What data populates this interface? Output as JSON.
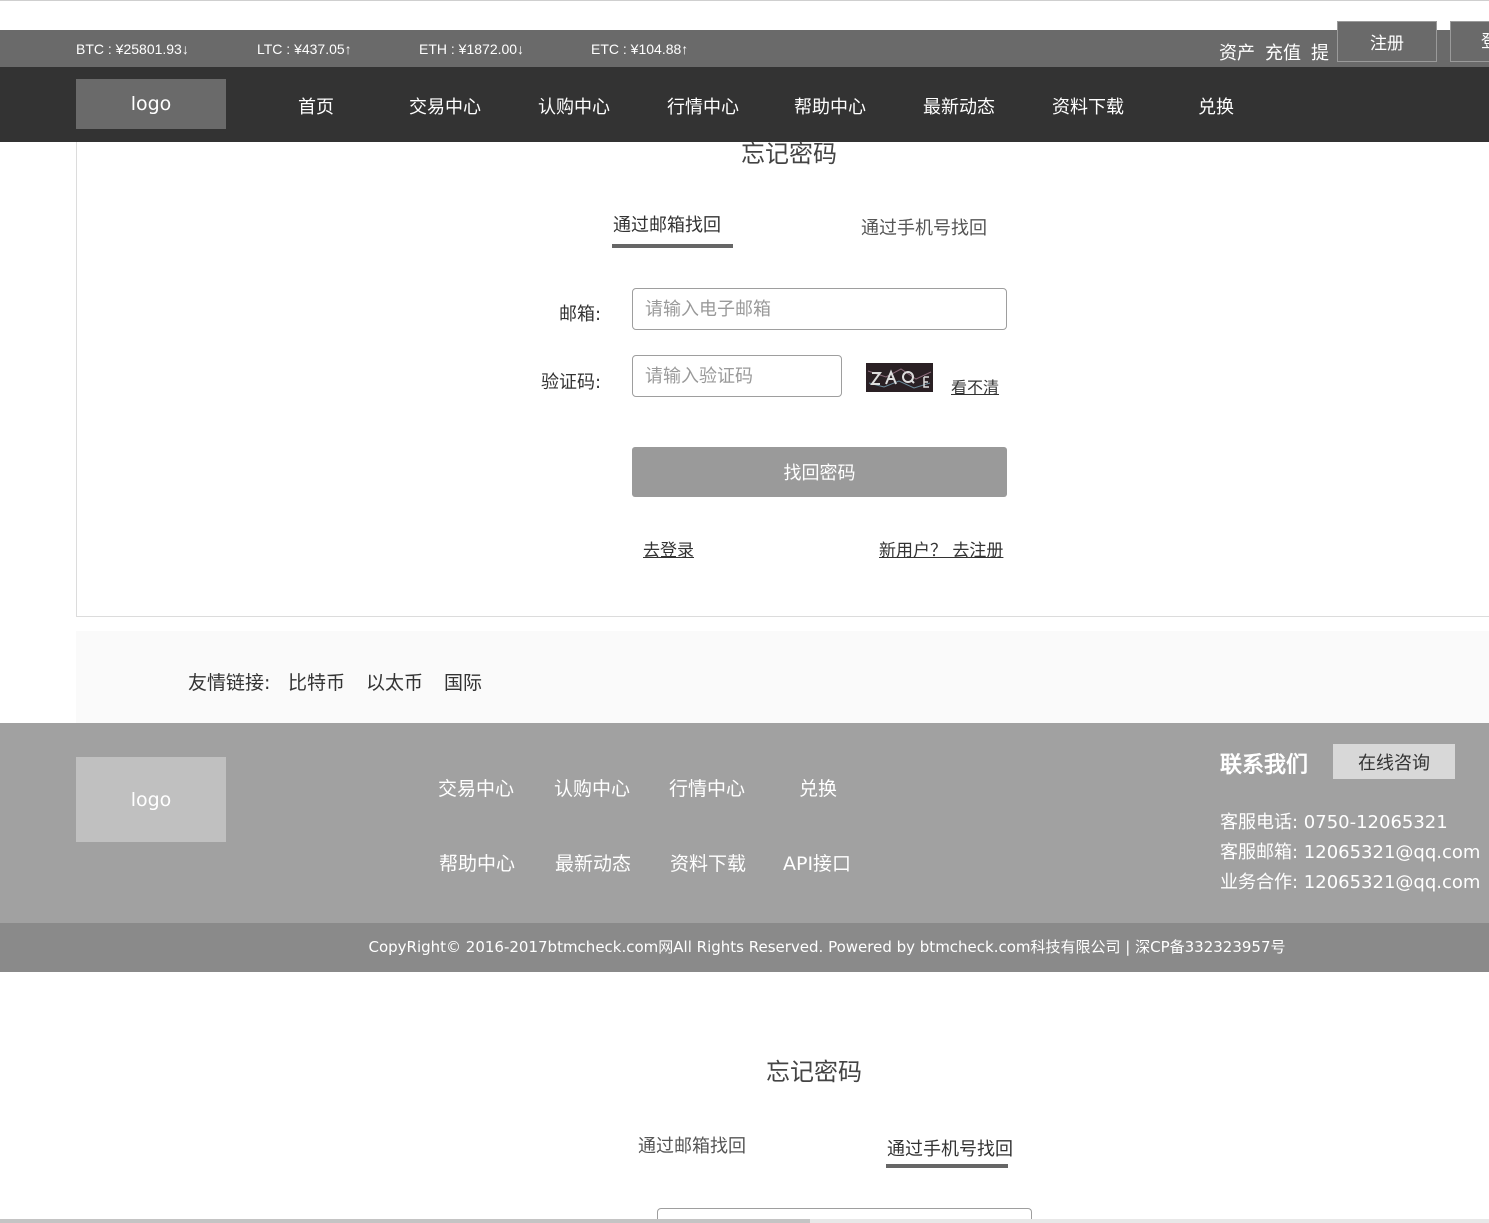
{
  "ticker": [
    {
      "label": "BTC : ¥25801.93↓"
    },
    {
      "label": "LTC : ¥437.05↑"
    },
    {
      "label": "ETH : ¥1872.00↓"
    },
    {
      "label": "ETC : ¥104.88↑"
    }
  ],
  "user_links": {
    "assets": "资产",
    "recharge": "充值",
    "withdraw": "提",
    "register": "注册",
    "login": "登"
  },
  "nav": {
    "logo": "logo",
    "items": [
      "首页",
      "交易中心",
      "认购中心",
      "行情中心",
      "帮助中心",
      "最新动态",
      "资料下载",
      "兑换"
    ]
  },
  "form": {
    "title": "忘记密码",
    "tab_email": "通过邮箱找回",
    "tab_phone": "通过手机号找回",
    "email_label": "邮箱:",
    "email_placeholder": "请输入电子邮箱",
    "captcha_label": "验证码:",
    "captcha_placeholder": "请输入验证码",
    "captcha_refresh": "看不清",
    "submit": "找回密码",
    "to_login": "去登录",
    "to_register": "新用户？ 去注册"
  },
  "friends": {
    "label": "友情链接:",
    "items": [
      "比特币",
      "以太币",
      "国际"
    ]
  },
  "footer": {
    "logo": "logo",
    "nav_row1": [
      "交易中心",
      "认购中心",
      "行情中心",
      "兑换"
    ],
    "nav_row2": [
      "帮助中心",
      "最新动态",
      "资料下载",
      "API接口"
    ],
    "contact_title": "联系我们",
    "consult": "在线咨询",
    "phone": "客服电话:  0750-12065321",
    "email": "客服邮箱:  12065321@qq.com",
    "business": "业务合作:  12065321@qq.com",
    "copyright": "CopyRight© 2016-2017btmcheck.com网All Rights Reserved. Powered by btmcheck.com科技有限公司 |  深CP备332323957号"
  },
  "lower_form": {
    "title": "忘记密码",
    "tab_email": "通过邮箱找回",
    "tab_phone": "通过手机号找回"
  }
}
